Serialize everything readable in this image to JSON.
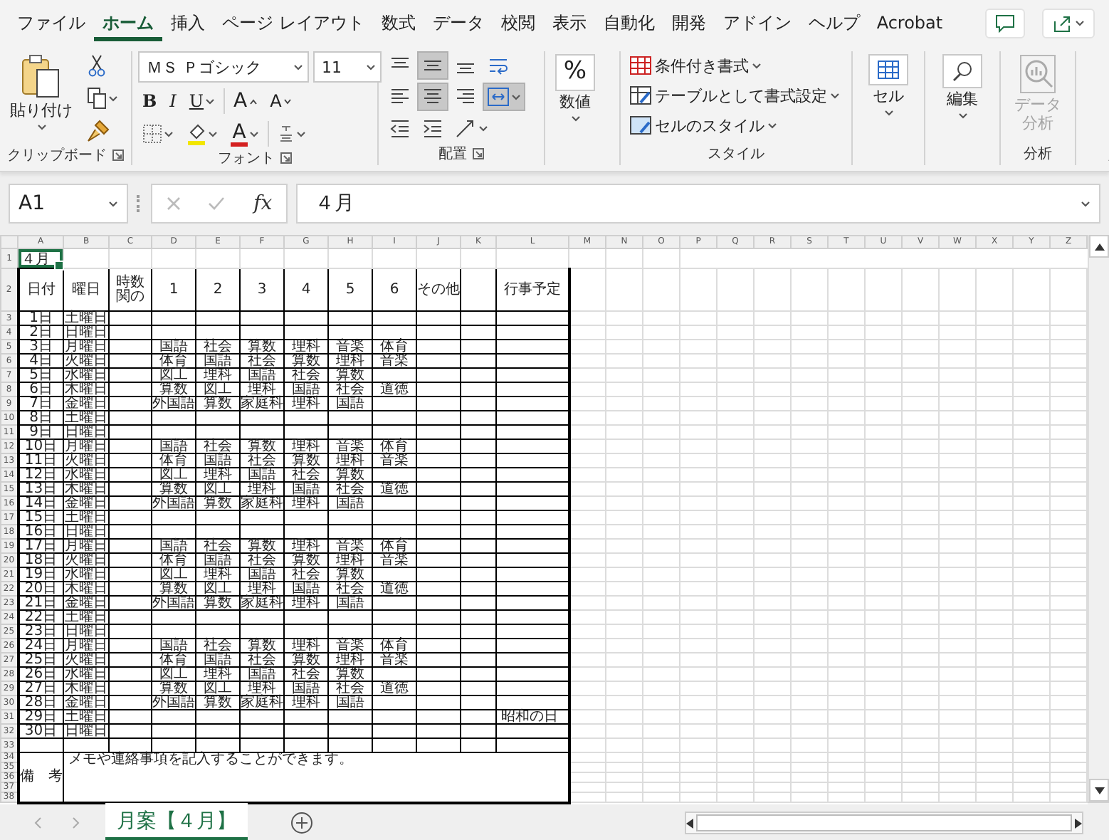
{
  "tabs": [
    {
      "label": "ファイル",
      "selected": false
    },
    {
      "label": "ホーム",
      "selected": true
    },
    {
      "label": "挿入",
      "selected": false
    },
    {
      "label": "ページ レイアウト",
      "selected": false
    },
    {
      "label": "数式",
      "selected": false
    },
    {
      "label": "データ",
      "selected": false
    },
    {
      "label": "校閲",
      "selected": false
    },
    {
      "label": "表示",
      "selected": false
    },
    {
      "label": "自動化",
      "selected": false
    },
    {
      "label": "開発",
      "selected": false
    },
    {
      "label": "アドイン",
      "selected": false
    },
    {
      "label": "ヘルプ",
      "selected": false
    },
    {
      "label": "Acrobat",
      "selected": false
    }
  ],
  "ribbon": {
    "clipboard": {
      "paste": "貼り付け",
      "label": "クリップボード"
    },
    "font": {
      "name": "ＭＳ Ｐゴシック",
      "size": "11",
      "styles": [
        "B",
        "I",
        "U"
      ],
      "grow": "A",
      "shrink": "A",
      "color_letter": "A",
      "label": "フォント"
    },
    "alignment": {
      "buttons": [
        {
          "selected": false
        },
        {
          "selected": true
        },
        {
          "selected": false
        },
        {
          "selected": false
        },
        {
          "selected": false
        },
        {
          "selected": true
        },
        {
          "selected": false
        },
        {
          "selected": true
        },
        {
          "selected": false
        },
        {
          "selected": false
        },
        {
          "selected": false
        }
      ],
      "label": "配置"
    },
    "number": {
      "symbol": "%",
      "button": "数値"
    },
    "styles": {
      "items": [
        "条件付き書式",
        "テーブルとして書式設定",
        "セルのスタイル"
      ],
      "label": "スタイル"
    },
    "cells": {
      "button": "セル"
    },
    "editing": {
      "button": "編集"
    },
    "analysis": {
      "button": "データ分析",
      "disabled": true,
      "label": "分析"
    }
  },
  "formula_bar": {
    "name_box": "A1",
    "function": "fx",
    "content": "４月"
  },
  "sheet": {
    "columns": [
      "A",
      "B",
      "C",
      "D",
      "E",
      "F",
      "G",
      "H",
      "I",
      "J",
      "K",
      "L",
      "M",
      "N",
      "O",
      "P",
      "Q",
      "R",
      "S",
      "T",
      "U",
      "V",
      "W",
      "X",
      "Y",
      "Z"
    ],
    "row_numbers": [
      "1",
      "2",
      "3",
      "4",
      "5",
      "6",
      "7",
      "8",
      "9",
      "10",
      "11",
      "12",
      "13",
      "14",
      "15",
      "16",
      "17",
      "18",
      "19",
      "20",
      "21",
      "22",
      "23",
      "24",
      "25",
      "26",
      "27",
      "28",
      "29",
      "30",
      "31",
      "32",
      "33",
      "34",
      "35",
      "36",
      "37",
      "38"
    ],
    "title": "４月",
    "headers": [
      "日付",
      "曜日",
      "時数関の",
      "1",
      "2",
      "3",
      "4",
      "5",
      "6",
      "その他"
    ],
    "schedule_header": "行事予定",
    "days": [
      {
        "date": "1日",
        "weekday": "土曜日"
      },
      {
        "date": "2日",
        "weekday": "日曜日"
      },
      {
        "date": "3日",
        "weekday": "月曜日",
        "periods": [
          "国語",
          "社会",
          "算数",
          "理科",
          "音楽",
          "体育"
        ]
      },
      {
        "date": "4日",
        "weekday": "火曜日",
        "periods": [
          "体育",
          "国語",
          "社会",
          "算数",
          "理科",
          "音楽"
        ]
      },
      {
        "date": "5日",
        "weekday": "水曜日",
        "periods": [
          "図工",
          "理科",
          "国語",
          "社会",
          "算数"
        ]
      },
      {
        "date": "6日",
        "weekday": "木曜日",
        "periods": [
          "算数",
          "図工",
          "理科",
          "国語",
          "社会",
          "道徳"
        ]
      },
      {
        "date": "7日",
        "weekday": "金曜日",
        "periods": [
          "外国語",
          "算数",
          "家庭科",
          "理科",
          "国語"
        ]
      },
      {
        "date": "8日",
        "weekday": "土曜日"
      },
      {
        "date": "9日",
        "weekday": "日曜日"
      },
      {
        "date": "10日",
        "weekday": "月曜日",
        "periods": [
          "国語",
          "社会",
          "算数",
          "理科",
          "音楽",
          "体育"
        ]
      },
      {
        "date": "11日",
        "weekday": "火曜日",
        "periods": [
          "体育",
          "国語",
          "社会",
          "算数",
          "理科",
          "音楽"
        ]
      },
      {
        "date": "12日",
        "weekday": "水曜日",
        "periods": [
          "図工",
          "理科",
          "国語",
          "社会",
          "算数"
        ]
      },
      {
        "date": "13日",
        "weekday": "木曜日",
        "periods": [
          "算数",
          "図工",
          "理科",
          "国語",
          "社会",
          "道徳"
        ]
      },
      {
        "date": "14日",
        "weekday": "金曜日",
        "periods": [
          "外国語",
          "算数",
          "家庭科",
          "理科",
          "国語"
        ]
      },
      {
        "date": "15日",
        "weekday": "土曜日"
      },
      {
        "date": "16日",
        "weekday": "日曜日"
      },
      {
        "date": "17日",
        "weekday": "月曜日",
        "periods": [
          "国語",
          "社会",
          "算数",
          "理科",
          "音楽",
          "体育"
        ]
      },
      {
        "date": "18日",
        "weekday": "火曜日",
        "periods": [
          "体育",
          "国語",
          "社会",
          "算数",
          "理科",
          "音楽"
        ]
      },
      {
        "date": "19日",
        "weekday": "水曜日",
        "periods": [
          "図工",
          "理科",
          "国語",
          "社会",
          "算数"
        ]
      },
      {
        "date": "20日",
        "weekday": "木曜日",
        "periods": [
          "算数",
          "図工",
          "理科",
          "国語",
          "社会",
          "道徳"
        ]
      },
      {
        "date": "21日",
        "weekday": "金曜日",
        "periods": [
          "外国語",
          "算数",
          "家庭科",
          "理科",
          "国語"
        ]
      },
      {
        "date": "22日",
        "weekday": "土曜日"
      },
      {
        "date": "23日",
        "weekday": "日曜日"
      },
      {
        "date": "24日",
        "weekday": "月曜日",
        "periods": [
          "国語",
          "社会",
          "算数",
          "理科",
          "音楽",
          "体育"
        ]
      },
      {
        "date": "25日",
        "weekday": "火曜日",
        "periods": [
          "体育",
          "国語",
          "社会",
          "算数",
          "理科",
          "音楽"
        ]
      },
      {
        "date": "26日",
        "weekday": "水曜日",
        "periods": [
          "図工",
          "理科",
          "国語",
          "社会",
          "算数"
        ]
      },
      {
        "date": "27日",
        "weekday": "木曜日",
        "periods": [
          "算数",
          "図工",
          "理科",
          "国語",
          "社会",
          "道徳"
        ]
      },
      {
        "date": "28日",
        "weekday": "金曜日",
        "periods": [
          "外国語",
          "算数",
          "家庭科",
          "理科",
          "国語"
        ]
      },
      {
        "date": "29日",
        "weekday": "土曜日",
        "event": "昭和の日"
      },
      {
        "date": "30日",
        "weekday": "日曜日"
      }
    ],
    "notes_label": "備　考",
    "notes": "メモや連絡事項を記入することができます。"
  },
  "sheet_tabs": [
    {
      "label": "月案【４月】",
      "selected": true
    }
  ]
}
